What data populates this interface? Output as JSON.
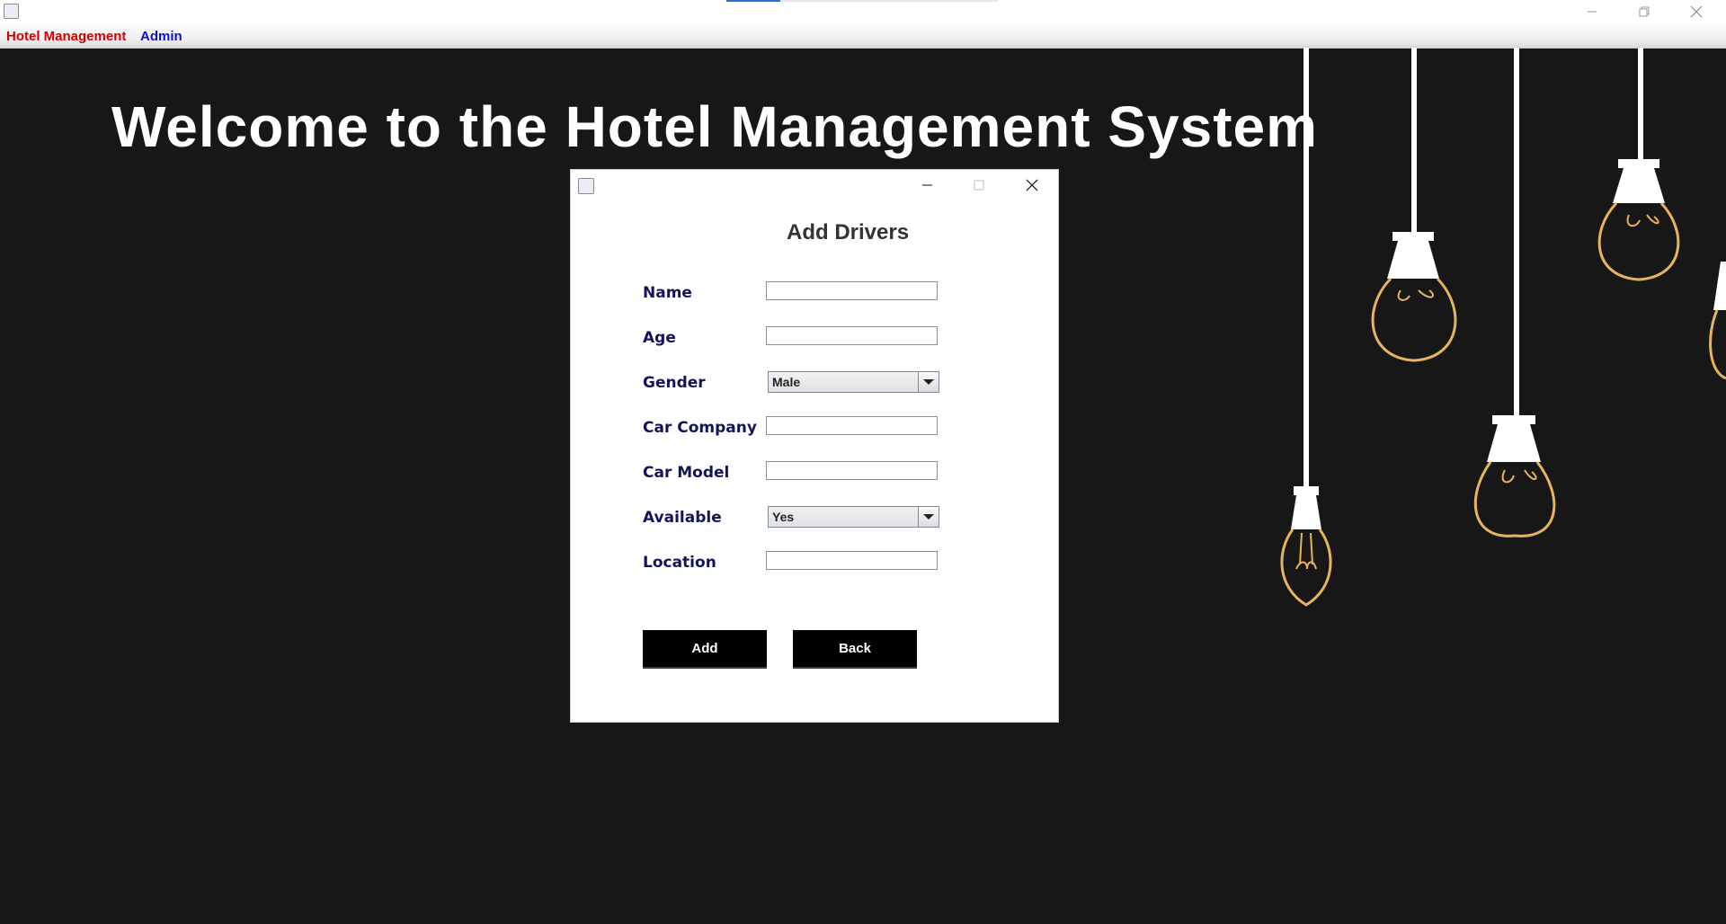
{
  "window": {
    "title": ""
  },
  "menubar": {
    "items": [
      {
        "label": "Hotel Management",
        "color": "#d40000"
      },
      {
        "label": "Admin",
        "color": "#0b12c9"
      }
    ]
  },
  "welcome_text": "Welcome to the Hotel Management System",
  "dialog": {
    "title": "Add Drivers",
    "fields": {
      "name": {
        "label": "Name",
        "value": ""
      },
      "age": {
        "label": "Age",
        "value": ""
      },
      "gender": {
        "label": "Gender",
        "selected": "Male"
      },
      "car_company": {
        "label": "Car Company",
        "value": ""
      },
      "car_model": {
        "label": "Car Model",
        "value": ""
      },
      "available": {
        "label": "Available",
        "selected": "Yes"
      },
      "location": {
        "label": "Location",
        "value": ""
      }
    },
    "add_label": "Add",
    "back_label": "Back"
  },
  "colors": {
    "background": "#171717",
    "label": "#14145c",
    "bulb_filament": "#e8b45a"
  }
}
